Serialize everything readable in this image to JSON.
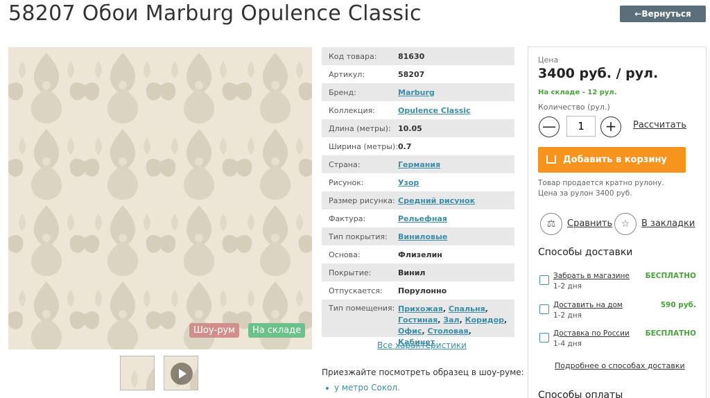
{
  "header": {
    "title": "58207 Обои Marburg Opulence Classic",
    "back_label": "←Вернуться назад"
  },
  "gallery": {
    "badge_showroom": "Шоу-рум",
    "badge_stock": "На складе"
  },
  "specs": {
    "rows": [
      {
        "key": "Код товара:",
        "value": "81630",
        "link": false
      },
      {
        "key": "Артикул:",
        "value": "58207",
        "link": false
      },
      {
        "key": "Бренд:",
        "value": "Marburg",
        "link": true
      },
      {
        "key": "Коллекция:",
        "value": "Opulence Classic",
        "link": true
      },
      {
        "key": "Длина (метры):",
        "value": "10.05",
        "link": false
      },
      {
        "key": "Ширина (метры):",
        "value": "0.7",
        "link": false
      },
      {
        "key": "Страна:",
        "value": "Германия",
        "link": true
      },
      {
        "key": "Рисунок:",
        "value": "Узор",
        "link": true
      },
      {
        "key": "Размер рисунка:",
        "value": "Средний рисунок",
        "link": true
      },
      {
        "key": "Фактура:",
        "value": "Рельефная",
        "link": true
      },
      {
        "key": "Тип покрытия:",
        "value": "Виниловые",
        "link": true
      },
      {
        "key": "Основа:",
        "value": "Флизелин",
        "link": false
      },
      {
        "key": "Покрытие:",
        "value": "Винил",
        "link": false
      },
      {
        "key": "Отпускается:",
        "value": "Порулонно",
        "link": false
      }
    ],
    "room_key": "Тип помещения:",
    "rooms": [
      "Прихожая",
      "Спальня",
      "Гостиная",
      "Зал",
      "Коридор",
      "Офис",
      "Столовая",
      "Кабинет"
    ],
    "all_link": "Все характеристики"
  },
  "visit": {
    "text": "Приезжайте посмотреть образец в шоу-руме:",
    "item": "у метро Сокол"
  },
  "buy": {
    "price_label": "Цена",
    "price": "3400 руб. / рул.",
    "stock": "На складе - 12 рул.",
    "qty_label": "Количество (рул.)",
    "qty_value": "1",
    "minus": "—",
    "plus": "+",
    "calc": "Рассчитать",
    "cart": "Добавить в корзину",
    "note_line1": "Товар продается кратно рулону.",
    "note_line2": "Цена за рулон 3400 руб.",
    "compare": "Сравнить",
    "bookmark": "В закладки",
    "delivery_title": "Способы доставки",
    "delivery": [
      {
        "name": "Забрать в магазине",
        "days": "1-2 дня",
        "cost": "БЕСПЛАТНО",
        "icon": "store-icon"
      },
      {
        "name": "Доставить на дом",
        "days": "1-2 дня",
        "cost": "590 руб.",
        "icon": "truck-icon"
      },
      {
        "name": "Доставка по России",
        "days": "1-4 дня",
        "cost": "БЕСПЛАТНО",
        "icon": "russia-map-icon"
      }
    ],
    "more_delivery": "Подробнее о способах доставки",
    "payment_title": "Способы оплаты"
  },
  "colors": {
    "accent_orange": "#f7941d",
    "stock_green": "#4aa33b",
    "link_teal": "#3d8da8",
    "back_button": "#5b6f7a"
  }
}
